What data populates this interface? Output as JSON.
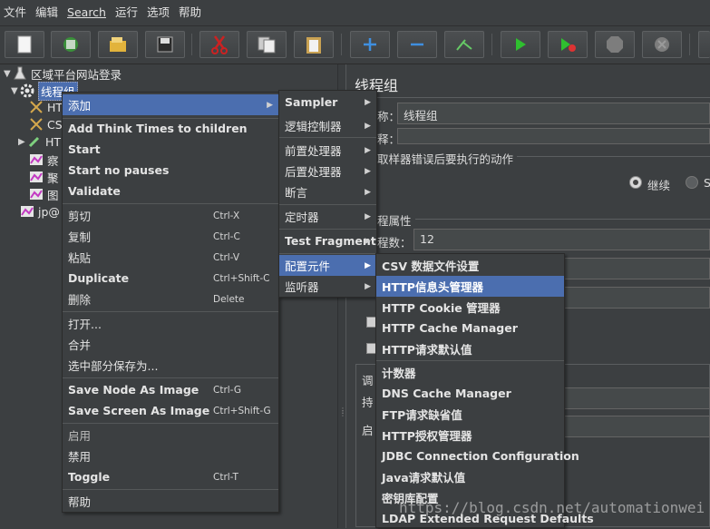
{
  "menubar": [
    "文件",
    "编辑",
    "Search",
    "运行",
    "选项",
    "帮助"
  ],
  "toolbar": {
    "buttons": [
      "new-icon",
      "templates-icon",
      "open-icon",
      "save-icon",
      "cut-icon",
      "copy-icon",
      "paste-icon",
      "expand-icon",
      "collapse-icon",
      "toggle-icon",
      "start-icon",
      "start-no-pauses-icon",
      "stop-icon",
      "shutdown-icon",
      "clear-icon"
    ]
  },
  "tree": {
    "root": "区域平台网站登录",
    "thread_group": "线程组",
    "children": [
      "HT",
      "CS",
      "HT",
      "察",
      "聚",
      "图"
    ],
    "sibling": "jp@"
  },
  "panel": {
    "title": "线程组",
    "name_label": "称：",
    "name_value": "线程组",
    "comment_label": "释：",
    "error_section": "取样器错误后要执行的动作",
    "continue_label": "继续",
    "radio_next": "S",
    "props_section": "程属性",
    "threads_label": "程数：",
    "threads_value": "12",
    "sched_label1": "调",
    "sched_label2": "持",
    "sched_label3": "启"
  },
  "menu1": {
    "items": [
      {
        "label": "添加",
        "arrow": true,
        "selected": true
      },
      {
        "label": "Add Think Times to children"
      },
      {
        "label": "Start"
      },
      {
        "label": "Start no pauses"
      },
      {
        "label": "Validate"
      },
      {
        "label": "剪切",
        "shortcut": "Ctrl-X"
      },
      {
        "label": "复制",
        "shortcut": "Ctrl-C"
      },
      {
        "label": "粘贴",
        "shortcut": "Ctrl-V"
      },
      {
        "label": "Duplicate",
        "shortcut": "Ctrl+Shift-C"
      },
      {
        "label": "删除",
        "shortcut": "Delete"
      },
      {
        "label": "打开..."
      },
      {
        "label": "合并"
      },
      {
        "label": "选中部分保存为..."
      },
      {
        "label": "Save Node As Image",
        "shortcut": "Ctrl-G"
      },
      {
        "label": "Save Screen As Image",
        "shortcut": "Ctrl+Shift-G"
      },
      {
        "label": "启用"
      },
      {
        "label": "禁用"
      },
      {
        "label": "Toggle",
        "shortcut": "Ctrl-T"
      },
      {
        "label": "帮助"
      }
    ]
  },
  "menu2": {
    "items": [
      {
        "label": "Sampler"
      },
      {
        "label": "逻辑控制器"
      },
      {
        "label": "前置处理器"
      },
      {
        "label": "后置处理器"
      },
      {
        "label": "断言"
      },
      {
        "label": "定时器"
      },
      {
        "label": "Test Fragment"
      },
      {
        "label": "配置元件"
      },
      {
        "label": "监听器"
      }
    ]
  },
  "menu3": {
    "items": [
      {
        "label": "CSV 数据文件设置"
      },
      {
        "label": "HTTP信息头管理器"
      },
      {
        "label": "HTTP Cookie 管理器"
      },
      {
        "label": "HTTP Cache Manager"
      },
      {
        "label": "HTTP请求默认值"
      },
      {
        "label": "计数器"
      },
      {
        "label": "DNS Cache Manager"
      },
      {
        "label": "FTP请求缺省值"
      },
      {
        "label": "HTTP授权管理器"
      },
      {
        "label": "JDBC Connection Configuration"
      },
      {
        "label": "Java请求默认值"
      },
      {
        "label": "密钥库配置"
      },
      {
        "label": "LDAP Extended Request Defaults"
      }
    ]
  },
  "watermark": "https://blog.csdn.net/automationwei",
  "colors": {
    "background": "#3c3f41",
    "selection": "#4b6eaf",
    "text": "#e4e4e4"
  }
}
